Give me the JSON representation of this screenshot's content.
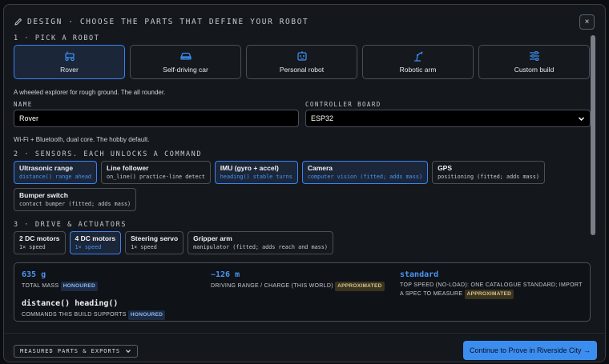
{
  "header": {
    "title": "Design · choose the parts that define your robot",
    "close_label": "×"
  },
  "section1": {
    "title": "1 · Pick a robot",
    "robots": [
      {
        "label": "Rover",
        "icon": "rover-icon",
        "selected": true
      },
      {
        "label": "Self-driving car",
        "icon": "car-icon",
        "selected": false
      },
      {
        "label": "Personal robot",
        "icon": "robot-face-icon",
        "selected": false
      },
      {
        "label": "Robotic arm",
        "icon": "robotic-arm-icon",
        "selected": false
      },
      {
        "label": "Custom build",
        "icon": "sliders-icon",
        "selected": false
      }
    ],
    "robot_description": "A wheeled explorer for rough ground. The all rounder."
  },
  "name_field": {
    "label": "Name",
    "value": "Rover"
  },
  "controller": {
    "label": "Controller board",
    "value": "ESP32",
    "description": "Wi-Fi + Bluetooth, dual core. The hobby default."
  },
  "section2": {
    "title": "2 · Sensors. Each unlocks a command",
    "sensors": [
      {
        "name": "Ultrasonic range",
        "detail": "distance() range ahead",
        "on": true
      },
      {
        "name": "Line follower",
        "detail": "on_line() practice-line detect",
        "on": false
      },
      {
        "name": "IMU (gyro + accel)",
        "detail": "heading() stable turns",
        "on": true
      },
      {
        "name": "Camera",
        "detail": "computer vision (fitted; adds mass)",
        "on": true
      },
      {
        "name": "GPS",
        "detail": "positioning (fitted; adds mass)",
        "on": false
      },
      {
        "name": "Bumper switch",
        "detail": "contact bumper (fitted; adds mass)",
        "on": false
      }
    ]
  },
  "section3": {
    "title": "3 · Drive & actuators",
    "drives": [
      {
        "name": "2 DC motors",
        "detail": "1× speed",
        "on": false
      },
      {
        "name": "4 DC motors",
        "detail": "1× speed",
        "on": true
      },
      {
        "name": "Steering servo",
        "detail": "1× speed",
        "on": false
      },
      {
        "name": "Gripper arm",
        "detail": "manipulator (fitted; adds reach and mass)",
        "on": false
      }
    ]
  },
  "stats": {
    "mass": {
      "value": "635 g",
      "label": "Total mass",
      "badge": "HONOURED"
    },
    "range": {
      "value": "~126 m",
      "label": "Driving range / charge (this world)",
      "badge": "APPROXIMATED"
    },
    "speed": {
      "value": "standard",
      "label": "Top speed (no-load): one catalogue standard; import a spec to measure",
      "badge": "APPROXIMATED"
    },
    "commands": {
      "value": "distance() heading()",
      "label": "Commands this build supports",
      "badge": "HONOURED"
    }
  },
  "footer": {
    "exports_label": "MEASURED PARTS & EXPORTS",
    "continue_label": "Continue to Prove in Riverside City →"
  },
  "colors": {
    "accent": "#3b8ef0",
    "selected_border": "#3b82f6",
    "background": "#14171c"
  }
}
